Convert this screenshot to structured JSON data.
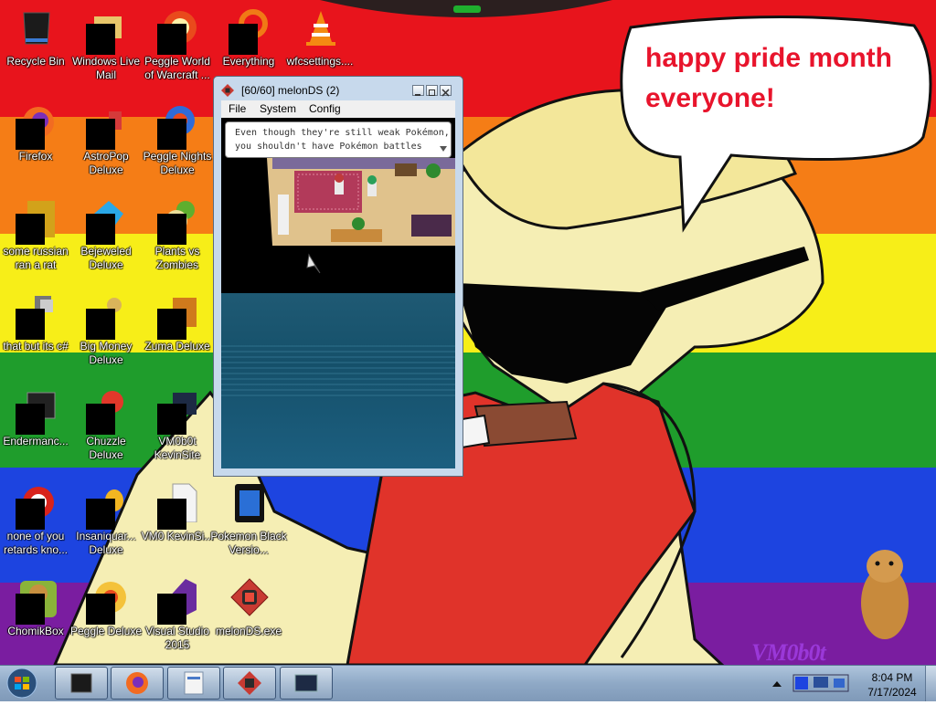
{
  "wallpaper": {
    "stripe_colors": [
      "#e8141c",
      "#f57d16",
      "#f7ee18",
      "#1f9d2c",
      "#1d44e0",
      "#7a1da0"
    ],
    "speech_bubble": "happy pride month\neveryone!",
    "signature": "VM0b0t"
  },
  "desktop_icons": [
    {
      "label": "Recycle Bin"
    },
    {
      "label": "Windows Live Mail"
    },
    {
      "label": "Peggle World of Warcraft ..."
    },
    {
      "label": "Everything"
    },
    {
      "label": "wfcsettings...."
    },
    {
      "label": "Firefox"
    },
    {
      "label": "AstroPop Deluxe"
    },
    {
      "label": "Peggle Nights Deluxe"
    },
    {
      "label": "some russian ran a rat"
    },
    {
      "label": "Bejeweled Deluxe"
    },
    {
      "label": "Plants vs Zombies"
    },
    {
      "label": "that but its c#"
    },
    {
      "label": "Big Money Deluxe"
    },
    {
      "label": "Zuma Deluxe"
    },
    {
      "label": "Endermanc..."
    },
    {
      "label": "Chuzzle Deluxe"
    },
    {
      "label": "VM0b0t KevinSite"
    },
    {
      "label": "none of you retards kno..."
    },
    {
      "label": "Insaniquar... Deluxe"
    },
    {
      "label": "VM0 KevinSi..."
    },
    {
      "label": "Pokemon Black Versio..."
    },
    {
      "label": "ChomikBox"
    },
    {
      "label": "Peggle Deluxe"
    },
    {
      "label": "Visual Studio 2015"
    },
    {
      "label": "melonDS.exe"
    }
  ],
  "melonds": {
    "title": "[60/60] melonDS (2)",
    "menu": [
      "File",
      "System",
      "Config"
    ],
    "dialog_line1": "Even though they're still weak Pokémon,",
    "dialog_line2": "you shouldn't have Pokémon battles"
  },
  "taskbar": {
    "buttons": [
      "terminal-app",
      "firefox",
      "document-app",
      "melonds",
      "window-app"
    ],
    "clock_time": "8:04 PM",
    "clock_date": "7/17/2024"
  }
}
